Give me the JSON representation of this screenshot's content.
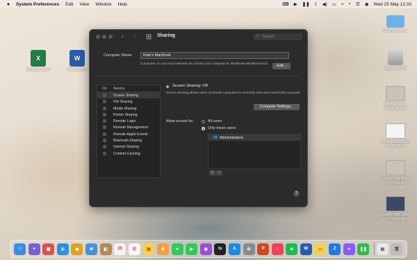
{
  "menubar": {
    "app_name": "System Preferences",
    "items": [
      "Edit",
      "View",
      "Window",
      "Help"
    ],
    "datetime": "Wed 25 May  12:33"
  },
  "desktop": {
    "left_icons": [
      {
        "label": "Microsoft Excel",
        "icon": "excel-icon",
        "glyph": "X"
      },
      {
        "label": "Microsoft Wo",
        "icon": "word-icon",
        "glyph": "W"
      }
    ],
    "right_icons": [
      {
        "label": "Relocated Items",
        "icon": "folder-icon"
      },
      {
        "label": "Macintosh HD",
        "icon": "drive-icon"
      },
      {
        "label": "Touchstone S... 05.38.12.pptx",
        "icon": "document-icon"
      },
      {
        "label": "Screen Shot 2022-0...18.36.34",
        "icon": "screenshot-icon"
      },
      {
        "label": "Screen Shot 2022-0...12.32.30",
        "icon": "screenshot-icon"
      },
      {
        "label": "Screen Shot 2022-0...12.32.39",
        "icon": "screenshot-icon"
      }
    ]
  },
  "window": {
    "title": "Sharing",
    "search_placeholder": "Search",
    "computer_name_label": "Computer Name:",
    "computer_name_value": "Kate's MacBook",
    "computer_name_note": "Computers on your local network can access your computer at: MacBooks-MacBook.local",
    "edit_button": "Edit...",
    "services_header_on": "On",
    "services_header_service": "Service",
    "services": [
      "Screen Sharing",
      "File Sharing",
      "Media Sharing",
      "Printer Sharing",
      "Remote Login",
      "Remote Management",
      "Remote Apple Events",
      "Bluetooth Sharing",
      "Internet Sharing",
      "Content Caching"
    ],
    "selected_service": "Screen Sharing",
    "status": "Screen Sharing: Off",
    "status_desc": "Screen Sharing allows users of remote computers to remotely view and control this computer.",
    "computer_settings_button": "Computer Settings...",
    "allow_access_label": "Allow access for:",
    "radio_all": "All users",
    "radio_only": "Only these users:",
    "radio_selected": "only",
    "users": [
      "Administrators"
    ],
    "add_label": "+",
    "remove_label": "−",
    "help_label": "?"
  },
  "dock": {
    "apps": [
      {
        "name": "finder-icon",
        "color": "#3b8de0",
        "glyph": "☺"
      },
      {
        "name": "siri-icon",
        "color": "#7a5fd6",
        "glyph": "●"
      },
      {
        "name": "launchpad-icon",
        "color": "#d9534f",
        "glyph": "▦"
      },
      {
        "name": "safari-icon",
        "color": "#2f8fe0",
        "glyph": "◎"
      },
      {
        "name": "chrome-icon",
        "color": "#e0a020",
        "glyph": "◉"
      },
      {
        "name": "mail-icon",
        "color": "#4a90d9",
        "glyph": "✉"
      },
      {
        "name": "contacts-icon",
        "color": "#b08a5a",
        "glyph": "◧"
      },
      {
        "name": "calendar-icon",
        "color": "#f3f3f3",
        "glyph": "25"
      },
      {
        "name": "reminders-icon",
        "color": "#f5f5f5",
        "glyph": "☰"
      },
      {
        "name": "notes-icon",
        "color": "#f2d24b",
        "glyph": "▤"
      },
      {
        "name": "photos-icon",
        "color": "#f0a040",
        "glyph": "✿"
      },
      {
        "name": "messages-icon",
        "color": "#35c75a",
        "glyph": "✦"
      },
      {
        "name": "facetime-icon",
        "color": "#35c75a",
        "glyph": "▶"
      },
      {
        "name": "podcasts-icon",
        "color": "#9b4fd6",
        "glyph": "◍"
      },
      {
        "name": "tv-icon",
        "color": "#222222",
        "glyph": "tv"
      },
      {
        "name": "appstore-icon",
        "color": "#1e88e5",
        "glyph": "A"
      },
      {
        "name": "system-preferences-icon",
        "color": "#8a8a8a",
        "glyph": "⚙"
      },
      {
        "name": "powerpoint-icon",
        "color": "#d24726",
        "glyph": "P"
      },
      {
        "name": "music-icon",
        "color": "#f0435a",
        "glyph": "♪"
      },
      {
        "name": "spotify-icon",
        "color": "#1db954",
        "glyph": "≋"
      },
      {
        "name": "word-icon",
        "color": "#2a5caa",
        "glyph": "W"
      },
      {
        "name": "stickies-icon",
        "color": "#f2d24b",
        "glyph": "▭"
      },
      {
        "name": "zalo-icon",
        "color": "#1f7ae0",
        "glyph": "Z"
      },
      {
        "name": "messenger-icon",
        "color": "#8a5cf6",
        "glyph": "✧"
      },
      {
        "name": "facetime-video-icon",
        "color": "#2fb84a",
        "glyph": "❚❚"
      }
    ],
    "extra": [
      {
        "name": "downloads-icon",
        "color": "#e8e8e8",
        "glyph": "▤"
      },
      {
        "name": "trash-icon",
        "color": "#bdbdbd",
        "glyph": "🗑"
      }
    ]
  }
}
